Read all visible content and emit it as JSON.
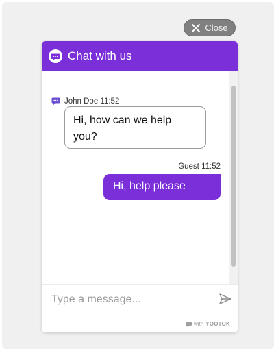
{
  "close_button": {
    "label": "Close",
    "icon": "close-icon"
  },
  "header": {
    "title": "Chat with us",
    "icon": "chat-bubble-icon",
    "color": "#7b2fd8"
  },
  "messages": [
    {
      "sender": "John Doe",
      "time": "11:52",
      "meta": "John Doe 11:52",
      "text": "Hi, how can we help you?",
      "side": "left"
    },
    {
      "sender": "Guest",
      "time": "11:52",
      "meta": "Guest 11:52",
      "text": "Hi, help please",
      "side": "right"
    }
  ],
  "composer": {
    "placeholder": "Type a message...",
    "value": "",
    "send_icon": "send-icon"
  },
  "footer": {
    "prefix": "with",
    "brand": "YOOTOK"
  }
}
